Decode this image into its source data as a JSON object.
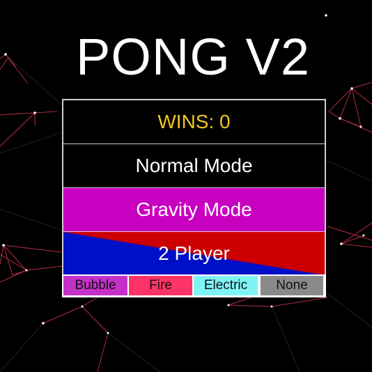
{
  "title": "PONG V2",
  "menu": {
    "wins": "WINS: 0",
    "normal_mode": "Normal Mode",
    "gravity_mode": "Gravity Mode",
    "two_player": "2 Player"
  },
  "effects": [
    {
      "label": "Bubble",
      "color": "#c531c8"
    },
    {
      "label": "Fire",
      "color": "#ff3366"
    },
    {
      "label": "Electric",
      "color": "#7ff4f7"
    },
    {
      "label": "None",
      "color": "#8a8a8a"
    }
  ],
  "colors": {
    "background": "#000000",
    "wins_text": "#f2c521",
    "gravity_mode": "#c800c0",
    "two_player_blue": "#0010c8",
    "two_player_red": "#cc0000",
    "network_lines": "#e23a4e"
  }
}
